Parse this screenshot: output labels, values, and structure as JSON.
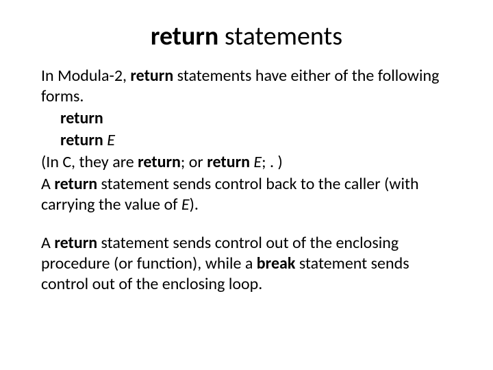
{
  "title": {
    "bold": "return",
    "rest": " statements"
  },
  "p1": {
    "a": "In Modula-2, ",
    "b": "return",
    "c": " statements have either of the following forms."
  },
  "form1": "return",
  "form2": {
    "kw": "return ",
    "expr": "E"
  },
  "p2": {
    "a": "(In C, they are ",
    "b": "return",
    "c": "; or ",
    "d": "return ",
    "e": "E",
    "f": "; . )"
  },
  "p3": {
    "a": "A ",
    "b": "return",
    "c": " statement sends control back to the caller (with carrying the value of ",
    "d": "E",
    "e": ")."
  },
  "p4": {
    "a": "A ",
    "b": "return",
    "c": " statement sends control out of the enclosing procedure (or function), while a ",
    "d": "break",
    "e": " statement sends control out of the enclosing loop."
  }
}
